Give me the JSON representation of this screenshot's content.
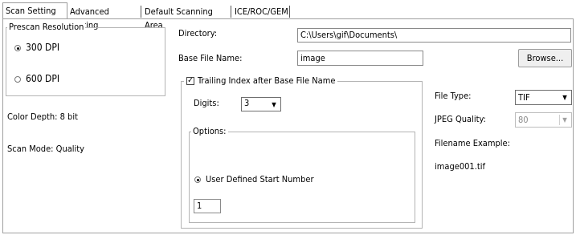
{
  "tabs": [
    {
      "label": "Scan Setting"
    },
    {
      "label": "Advanced Setting"
    },
    {
      "label": "Default Scanning Area"
    },
    {
      "label": "ICE/ROC/GEM"
    }
  ],
  "prescan": {
    "legend": "Prescan Resolution",
    "options": [
      {
        "label": "300 DPI",
        "checked": true
      },
      {
        "label": "600 DPI",
        "checked": false
      }
    ]
  },
  "color_depth": "Color Depth: 8 bit",
  "scan_mode": "Scan Mode: Quality",
  "directory": {
    "label": "Directory:",
    "value": "C:\\Users\\gif\\Documents\\"
  },
  "base_file": {
    "label": "Base File Name:",
    "value": "image"
  },
  "browse_label": "Browse...",
  "trailing": {
    "legend": "Trailing Index after Base File Name",
    "checked": true,
    "check_mark": "✓"
  },
  "digits": {
    "label": "Digits:",
    "value": "3"
  },
  "options": {
    "legend": "Options:",
    "radio_label": "User Defined Start Number",
    "radio_checked": true,
    "start_value": "1"
  },
  "file_type": {
    "label": "File Type:",
    "value": "TIF"
  },
  "jpeg_quality": {
    "label": "JPEG Quality:",
    "value": "80"
  },
  "filename_example": {
    "label": "Filename Example:",
    "value": "image001.tif"
  },
  "arrow_glyph": "▼"
}
